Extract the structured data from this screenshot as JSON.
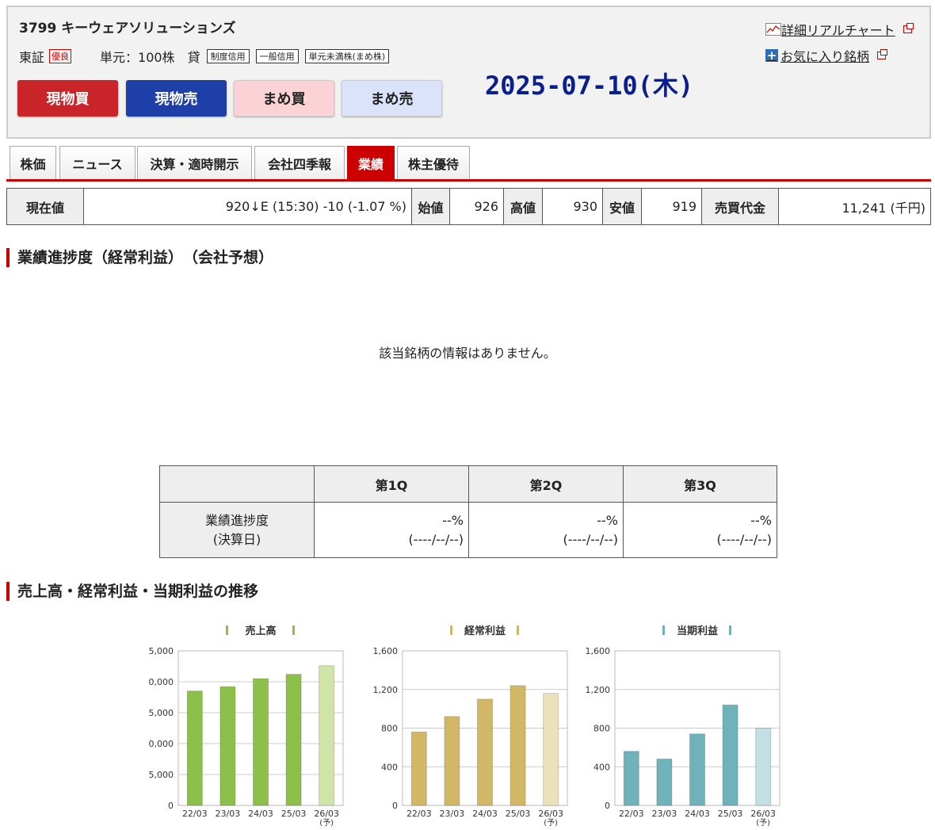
{
  "header": {
    "code": "3799",
    "name": "キーウェアソリューションズ",
    "market": "東証",
    "market_badge": "優良",
    "unit": "単元：100株",
    "lend": "貸",
    "tags": [
      "制度信用",
      "一般信用",
      "単元未満株(まめ株)"
    ],
    "buttons": [
      "現物買",
      "現物売",
      "まめ買",
      "まめ売"
    ],
    "date": "2025-07-10(木)",
    "link_chart": "詳細リアルチャート",
    "link_fav": "お気に入り銘柄"
  },
  "tabs": [
    "株価",
    "ニュース",
    "決算・適時開示",
    "会社四季報",
    "業績",
    "株主優待"
  ],
  "active_tab": "業績",
  "price": {
    "label_current": "現在値",
    "current": "920↓E (15:30) -10 (-1.07 %)",
    "label_open": "始値",
    "open": "926",
    "label_high": "高値",
    "high": "930",
    "label_low": "安値",
    "low": "919",
    "label_turnover": "売買代金",
    "turnover": "11,241 (千円)"
  },
  "progress": {
    "heading": "業績進捗度（経常利益）　（会社予想）",
    "no_info": "該当銘柄の情報はありません。",
    "cols": [
      "第1Q",
      "第2Q",
      "第3Q"
    ],
    "row_label_1": "業績進捗度",
    "row_label_2": "(決算日)",
    "pct": [
      "--%",
      "--%",
      "--%"
    ],
    "dates": [
      "(----/--/--)",
      "(----/--/--)",
      "(----/--/--)"
    ]
  },
  "trend_heading": "売上高・経常利益・当期利益の推移",
  "chart_data": [
    {
      "type": "bar",
      "title": "売上高",
      "categories": [
        "22/03",
        "23/03",
        "24/03",
        "25/03",
        "26/03"
      ],
      "forecast_label": "(予)",
      "values": [
        18500,
        19200,
        20500,
        21200,
        22600
      ],
      "ylim": [
        0,
        25000
      ],
      "yticks": [
        0,
        5000,
        10000,
        15000,
        20000,
        25000
      ],
      "ytick_labels": [
        "0",
        "5,000",
        "0,000",
        "5,000",
        "0,000",
        "5,000"
      ],
      "color": "#8dc04a",
      "forecast_color": "#cfe5a8",
      "marker_color": "#8dc04a"
    },
    {
      "type": "bar",
      "title": "経常利益",
      "categories": [
        "22/03",
        "23/03",
        "24/03",
        "25/03",
        "26/03"
      ],
      "forecast_label": "(予)",
      "values": [
        760,
        920,
        1100,
        1240,
        1160
      ],
      "ylim": [
        0,
        1600
      ],
      "yticks": [
        0,
        400,
        800,
        1200,
        1600
      ],
      "ytick_labels": [
        "0",
        "400",
        "800",
        "1,200",
        "1,600"
      ],
      "color": "#d2b866",
      "forecast_color": "#ede1bb",
      "marker_color": "#d2b866"
    },
    {
      "type": "bar",
      "title": "当期利益",
      "categories": [
        "22/03",
        "23/03",
        "24/03",
        "25/03",
        "26/03"
      ],
      "forecast_label": "(予)",
      "values": [
        560,
        480,
        740,
        1040,
        800
      ],
      "ylim": [
        0,
        1600
      ],
      "yticks": [
        0,
        400,
        800,
        1200,
        1600
      ],
      "ytick_labels": [
        "0",
        "400",
        "800",
        "1,200",
        "1,600"
      ],
      "color": "#6fb2ba",
      "forecast_color": "#c2e0e3",
      "marker_color": "#6fb2ba"
    }
  ]
}
